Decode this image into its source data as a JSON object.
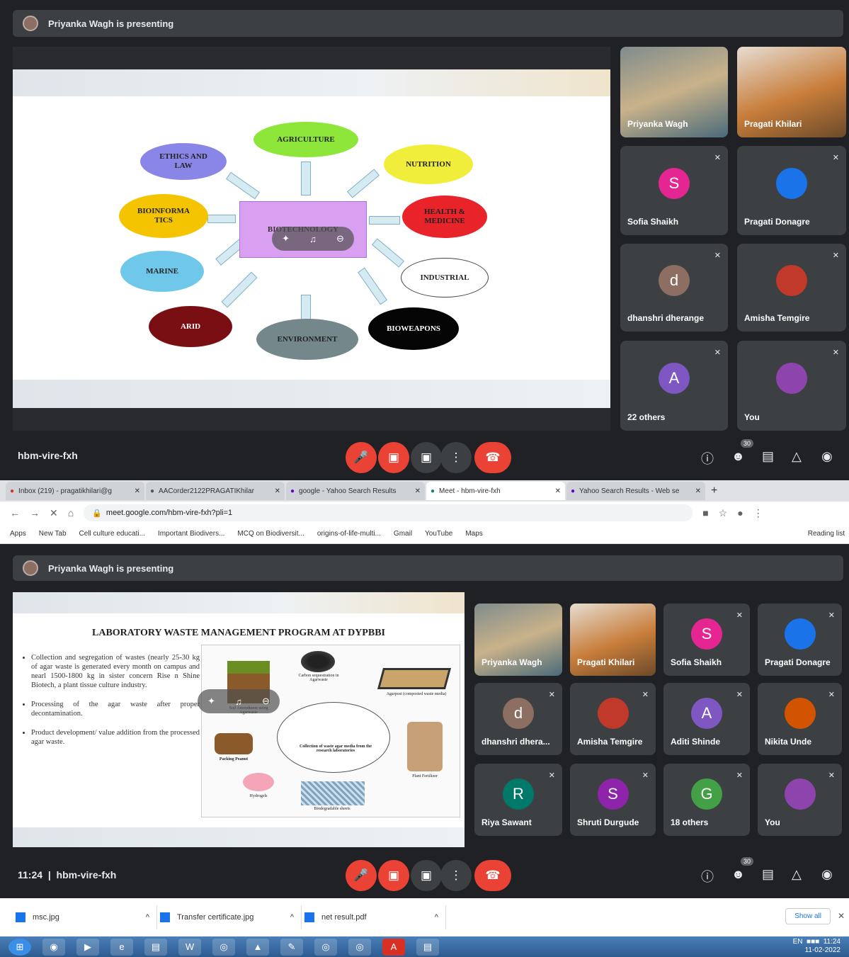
{
  "meet_top": {
    "presenting": "Priyanka Wagh is presenting",
    "meeting_code": "hbm-vire-fxh",
    "participant_count": "30",
    "slide": {
      "center": "BIOTECHNOLOGY",
      "nodes": {
        "agriculture": "AGRICULTURE",
        "nutrition": "NUTRITION",
        "health": "HEALTH & MEDICINE",
        "industrial": "INDUSTRIAL",
        "bioweapons": "BIOWEAPONS",
        "environment": "ENVIRONMENT",
        "arid": "ARID",
        "marine": "MARINE",
        "bioinformatics": "BIOINFORMA TICS",
        "ethics": "ETHICS AND LAW"
      }
    },
    "tiles": [
      {
        "name": "Priyanka Wagh",
        "type": "video"
      },
      {
        "name": "Pragati Khilari",
        "type": "video"
      },
      {
        "name": "Sofia Shaikh",
        "initial": "S",
        "color": "#e52592"
      },
      {
        "name": "Pragati Donagre",
        "initial": "",
        "color": "#1a73e8"
      },
      {
        "name": "dhanshri dherange",
        "initial": "d",
        "color": "#8d6e63"
      },
      {
        "name": "Amisha Temgire",
        "initial": "",
        "color": "#c0392b"
      },
      {
        "name": "22 others",
        "initial": "A",
        "color": "#7e57c2"
      },
      {
        "name": "You",
        "initial": "",
        "color": "#8e44ad"
      }
    ]
  },
  "browser": {
    "tabs": [
      {
        "label": "Inbox (219) - pragatikhilari@g",
        "icon": "gmail-icon"
      },
      {
        "label": "AACorder2122PRAGATIKhilar",
        "icon": "drive-icon"
      },
      {
        "label": "google - Yahoo Search Results",
        "icon": "yahoo-icon"
      },
      {
        "label": "Meet - hbm-vire-fxh",
        "icon": "meet-icon"
      },
      {
        "label": "Yahoo Search Results - Web se",
        "icon": "yahoo-icon"
      }
    ],
    "url": "meet.google.com/hbm-vire-fxh?pli=1",
    "bookmarks": [
      "Apps",
      "New Tab",
      "Cell culture educati...",
      "Important Biodivers...",
      "MCQ on Biodiversit...",
      "origins-of-life-multi...",
      "Gmail",
      "YouTube",
      "Maps"
    ],
    "reading_list": "Reading list"
  },
  "meet_bottom": {
    "presenting": "Priyanka Wagh is presenting",
    "time": "11:24",
    "meeting_code": "hbm-vire-fxh",
    "participant_count": "30",
    "slide": {
      "title": "LABORATORY WASTE MANAGEMENT PROGRAM AT DYPBBI",
      "bullets": [
        "Collection and segregation of wastes (nearly 25-30 kg of agar waste is generated every month on campus and nearl 1500-1800 kg in sister concern Rise n Shine Biotech, a plant tissue culture industry.",
        "Processing of the agar waste after proper decontamination.",
        "Product development/ value addition from the processed agar waste."
      ],
      "figure_labels": {
        "carbon": "Carbon sequestration in Agarwaste",
        "soil": "Soil Amendment using Agarwaste",
        "agarpost": "Agarpost (composted waste media)",
        "collection": "Collection of waste agar media from the research laboratories",
        "packing": "Packing Peanut",
        "plant": "Plant Fertilizer",
        "hydrogels": "Hydrogels",
        "sheets": "Biodegradable sheets"
      }
    },
    "tiles": [
      {
        "name": "Priyanka Wagh",
        "type": "video"
      },
      {
        "name": "Pragati Khilari",
        "type": "video"
      },
      {
        "name": "Sofia Shaikh",
        "initial": "S",
        "color": "#e52592"
      },
      {
        "name": "Pragati Donagre",
        "initial": "",
        "color": "#1a73e8"
      },
      {
        "name": "dhanshri dhera...",
        "initial": "d",
        "color": "#8d6e63"
      },
      {
        "name": "Amisha Temgire",
        "initial": "",
        "color": "#c0392b"
      },
      {
        "name": "Aditi Shinde",
        "initial": "A",
        "color": "#7e57c2"
      },
      {
        "name": "Nikita Unde",
        "initial": "",
        "color": "#d35400"
      },
      {
        "name": "Riya Sawant",
        "initial": "R",
        "color": "#00796b"
      },
      {
        "name": "Shruti Durgude",
        "initial": "S",
        "color": "#8e24aa"
      },
      {
        "name": "18 others",
        "initial": "G",
        "color": "#43a047"
      },
      {
        "name": "You",
        "initial": "",
        "color": "#8e44ad"
      }
    ]
  },
  "downloads": [
    {
      "name": "msc.jpg"
    },
    {
      "name": "Transfer certificate.jpg"
    },
    {
      "name": "net result.pdf"
    }
  ],
  "show_all": "Show all",
  "taskbar": {
    "lang": "EN",
    "time": "11:24",
    "date": "11-02-2022"
  }
}
